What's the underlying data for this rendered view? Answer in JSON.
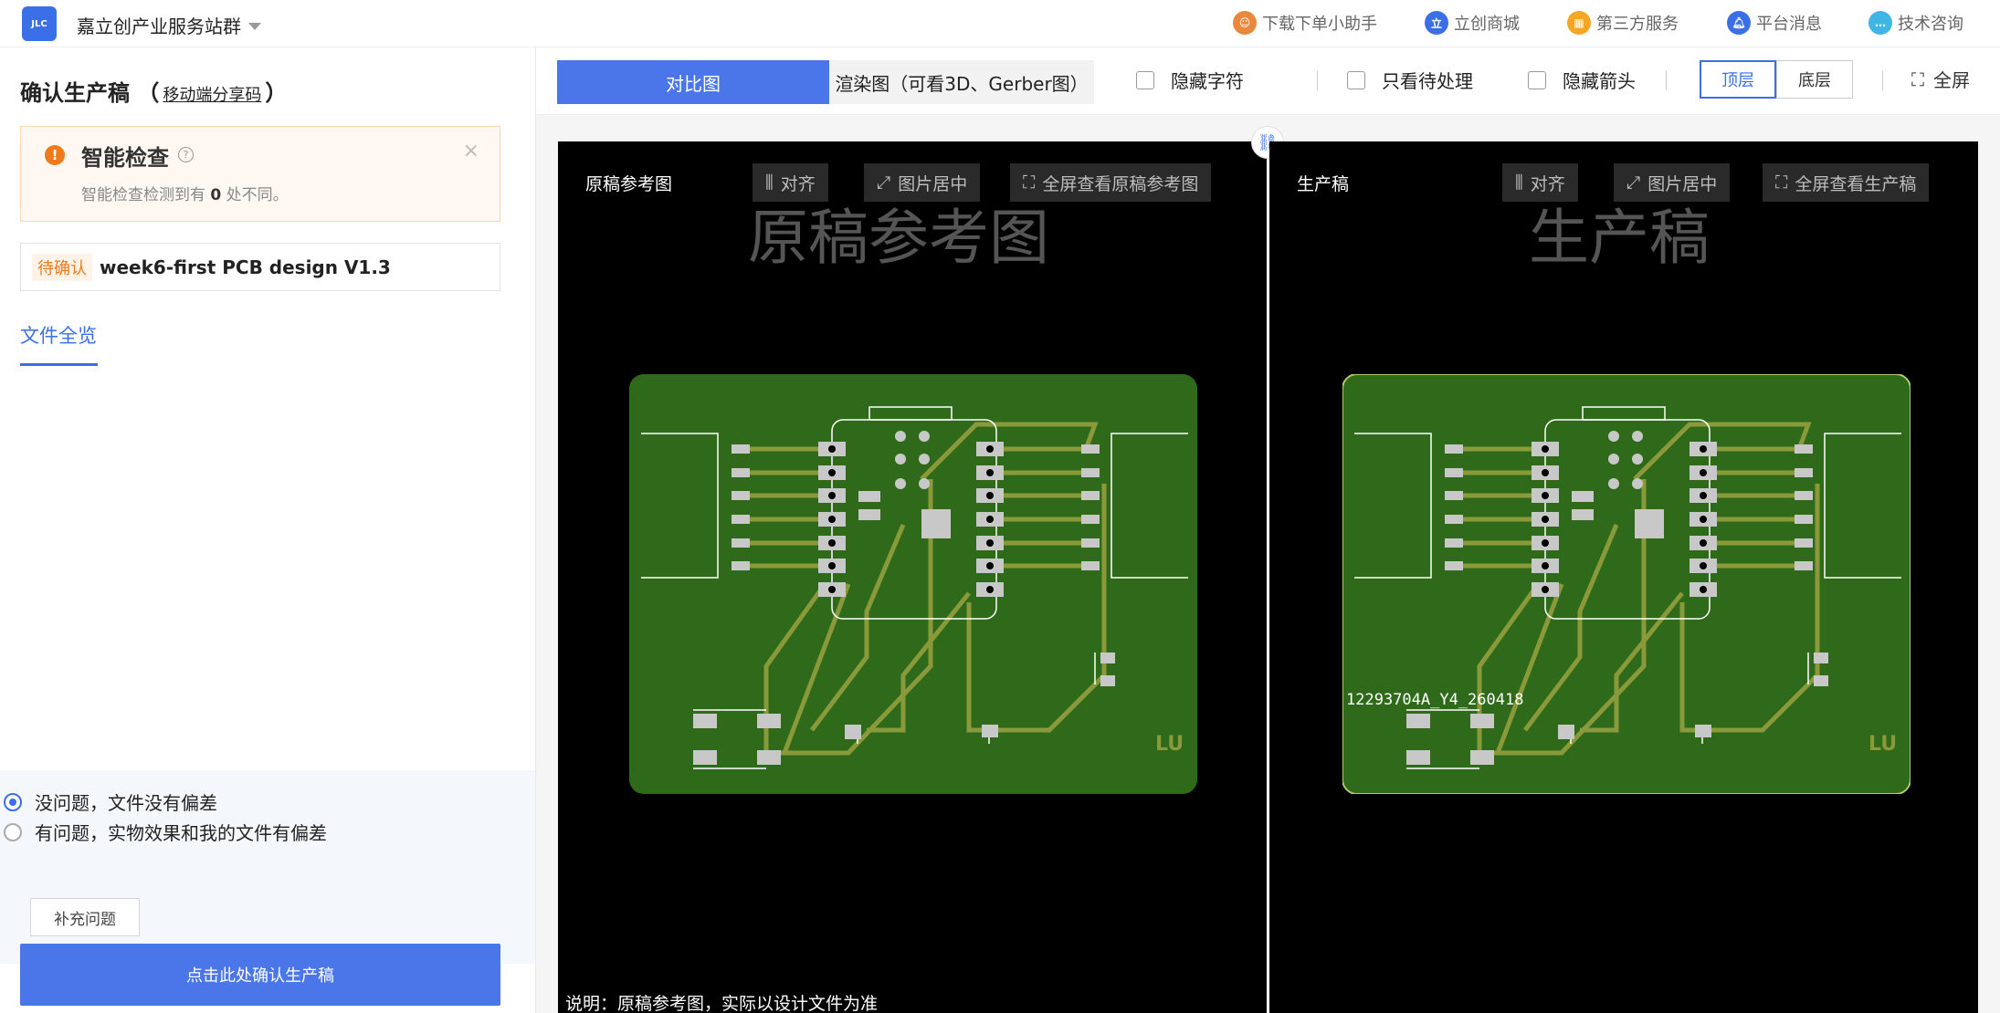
{
  "topnav": {
    "logo": "JLC",
    "site_title": "嘉立创产业服务站群",
    "items": [
      {
        "label": "下载下单小助手",
        "icon": "assistant-avatar-icon",
        "color": "#e9873c"
      },
      {
        "label": "立创商城",
        "icon": "lcsc-icon",
        "color": "#3b6fe8"
      },
      {
        "label": "第三方服务",
        "icon": "grid-apps-icon",
        "color": "#f5a623"
      },
      {
        "label": "平台消息",
        "icon": "bell-icon",
        "color": "#3b6fe8"
      },
      {
        "label": "技术咨询",
        "icon": "chat-icon",
        "color": "#3fb6e6"
      }
    ]
  },
  "left": {
    "title": "确认生产稿",
    "paren_open": "（",
    "share_link": "移动端分享码",
    "paren_close": "）",
    "check": {
      "title": "智能检查",
      "desc_prefix": "智能检查检测到有",
      "count": "0",
      "desc_suffix": "处不同。"
    },
    "file": {
      "status": "待确认",
      "name": "week6-first PCB design V1.3"
    },
    "tab": "文件全览",
    "options": [
      {
        "label": "没问题，文件没有偏差",
        "checked": true
      },
      {
        "label": "有问题，实物效果和我的文件有偏差",
        "checked": false
      }
    ],
    "supplement_button": "补充问题",
    "confirm_button": "点击此处确认生产稿"
  },
  "toolbar": {
    "view_compare": "对比图",
    "view_render": "渲染图（可看3D、Gerber图）",
    "hide_text": "隐藏字符",
    "only_pending": "只看待处理",
    "hide_arrows": "隐藏箭头",
    "top_layer": "顶层",
    "bottom_layer": "底层",
    "fullscreen": "全屏"
  },
  "compare": {
    "left": {
      "label": "原稿参考图",
      "align": "对齐",
      "center": "图片居中",
      "fullscreen": "全屏查看原稿参考图",
      "watermark": "原稿参考图"
    },
    "right": {
      "label": "生产稿",
      "align": "对齐",
      "center": "图片居中",
      "fullscreen": "全屏查看生产稿",
      "watermark": "生产稿",
      "order_code": "12293704A_Y4_260418"
    },
    "board_mark": "LU",
    "note": "说明：原稿参考图，实际以设计文件为准",
    "colors": {
      "board": "#2f6a1a",
      "trace": "#8a9a3a",
      "pad": "#c8c8c8"
    }
  }
}
